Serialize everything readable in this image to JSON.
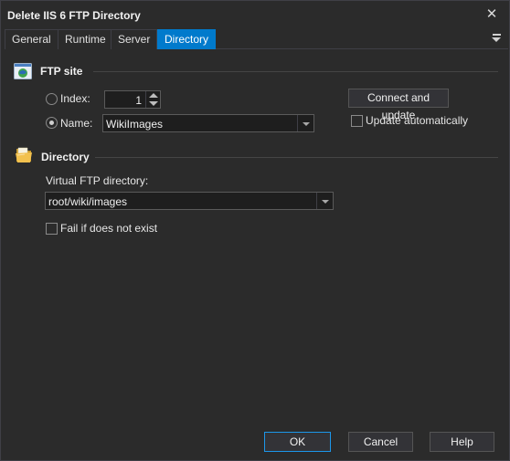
{
  "window": {
    "title": "Delete IIS 6 FTP Directory",
    "close_glyph": "✕"
  },
  "tabs": [
    {
      "label": "General",
      "active": false
    },
    {
      "label": "Runtime",
      "active": false
    },
    {
      "label": "Server",
      "active": false
    },
    {
      "label": "Directory",
      "active": true
    }
  ],
  "ftp_site": {
    "header": "FTP site",
    "index_label": "Index:",
    "index_value": "1",
    "index_selected": false,
    "name_label": "Name:",
    "name_value": "WikiImages",
    "name_selected": true,
    "connect_button": "Connect and update",
    "update_auto_label": "Update automatically",
    "update_auto_checked": false
  },
  "directory": {
    "header": "Directory",
    "virtual_dir_label": "Virtual FTP directory:",
    "virtual_dir_value": "root/wiki/images",
    "fail_label": "Fail if does not exist",
    "fail_checked": false
  },
  "buttons": {
    "ok": "OK",
    "cancel": "Cancel",
    "help": "Help"
  },
  "colors": {
    "accent": "#007acc",
    "background": "#2b2b2b",
    "input_bg": "#1e1e1e"
  }
}
